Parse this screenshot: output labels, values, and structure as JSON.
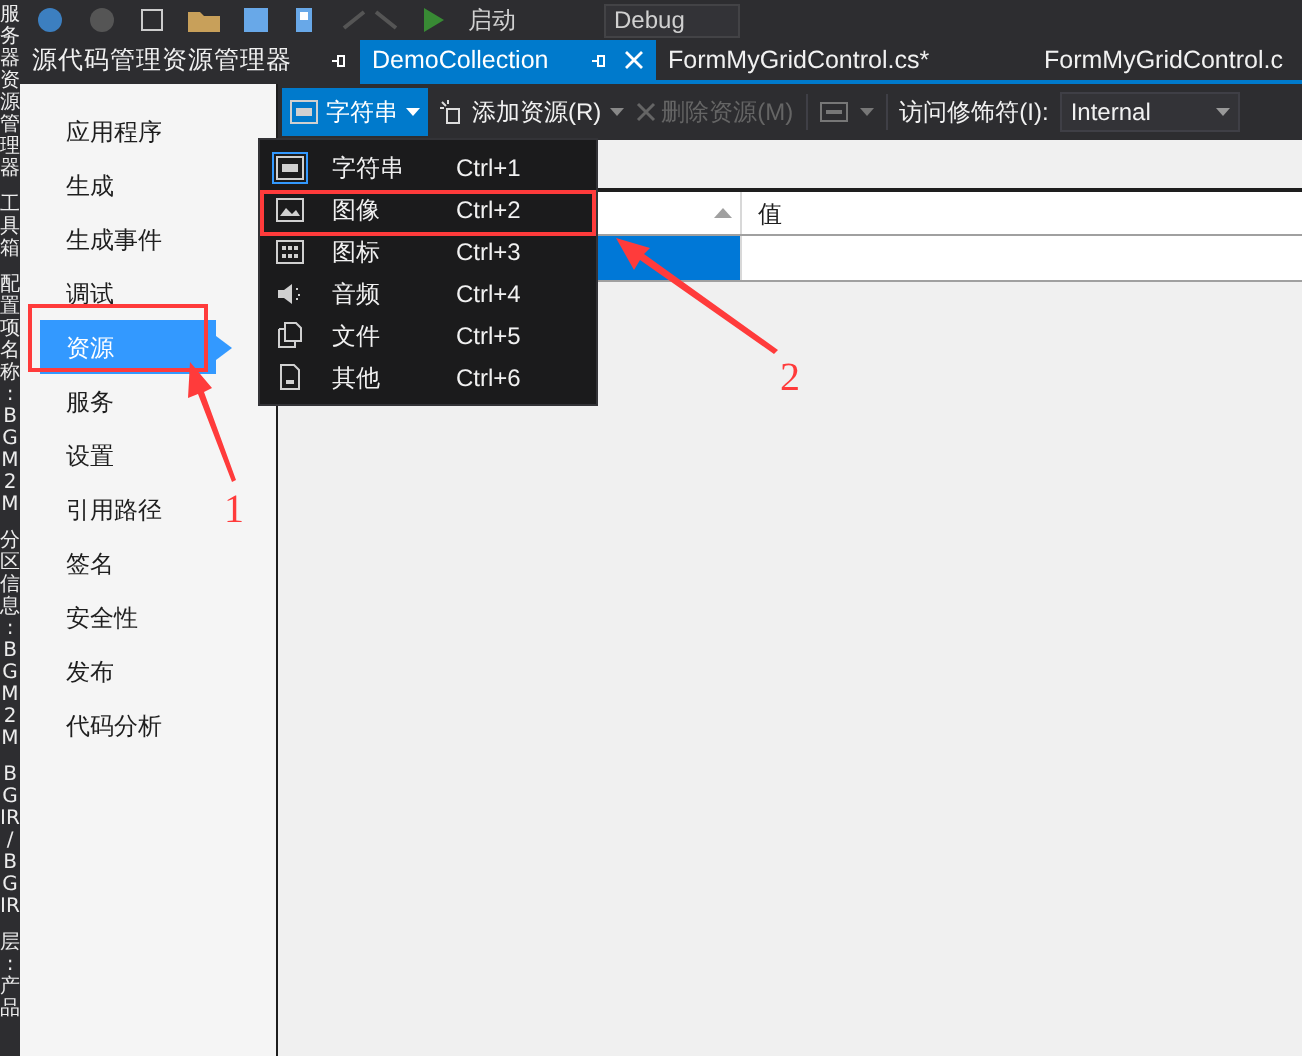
{
  "toolbar": {
    "run_label": "启动",
    "config": "Debug"
  },
  "side_strip": [
    {
      "label": "服务器资源管理器"
    },
    {
      "label": "工具箱"
    },
    {
      "label": "配置项名称:BGM2M"
    },
    {
      "label": "分区信息:BGM2M"
    },
    {
      "label": "BGIR/BGIR"
    },
    {
      "label": "层:产品"
    }
  ],
  "doc_tabs": [
    {
      "label": "源代码管理资源管理器",
      "kind": "tool",
      "selected": false
    },
    {
      "label": "DemoCollection",
      "kind": "doc",
      "selected": true
    },
    {
      "label": "FormMyGridControl.cs*",
      "kind": "doc",
      "selected": false
    },
    {
      "label": "FormMyGridControl.c",
      "kind": "doc",
      "selected": false
    }
  ],
  "nav": [
    {
      "label": "应用程序",
      "selected": false,
      "annotated": false
    },
    {
      "label": "生成",
      "selected": false,
      "annotated": false
    },
    {
      "label": "生成事件",
      "selected": false,
      "annotated": false
    },
    {
      "label": "调试",
      "selected": false,
      "annotated": false
    },
    {
      "label": "资源",
      "selected": true,
      "annotated": true
    },
    {
      "label": "服务",
      "selected": false,
      "annotated": false
    },
    {
      "label": "设置",
      "selected": false,
      "annotated": false
    },
    {
      "label": "引用路径",
      "selected": false,
      "annotated": false
    },
    {
      "label": "签名",
      "selected": false,
      "annotated": false
    },
    {
      "label": "安全性",
      "selected": false,
      "annotated": false
    },
    {
      "label": "发布",
      "selected": false,
      "annotated": false
    },
    {
      "label": "代码分析",
      "selected": false,
      "annotated": false
    }
  ],
  "resource_toolbar": {
    "type_button": "字符串",
    "add_button": "添加资源(R)",
    "remove_button": {
      "label": "删除资源(M)",
      "disabled": true
    },
    "access_label": "访问修饰符(I):",
    "access_value": "Internal"
  },
  "table": {
    "columns": [
      {
        "label": "值"
      }
    ],
    "rows": [
      {
        "selected": true
      }
    ]
  },
  "menu": {
    "items": [
      {
        "label": "字符串",
        "shortcut": "Ctrl+1",
        "kind": "string",
        "selected": true,
        "annotated": false
      },
      {
        "label": "图像",
        "shortcut": "Ctrl+2",
        "kind": "image",
        "selected": false,
        "annotated": true
      },
      {
        "label": "图标",
        "shortcut": "Ctrl+3",
        "kind": "icon",
        "selected": false,
        "annotated": false
      },
      {
        "label": "音频",
        "shortcut": "Ctrl+4",
        "kind": "audio",
        "selected": false,
        "annotated": false
      },
      {
        "label": "文件",
        "shortcut": "Ctrl+5",
        "kind": "file",
        "selected": false,
        "annotated": false
      },
      {
        "label": "其他",
        "shortcut": "Ctrl+6",
        "kind": "other",
        "selected": false,
        "annotated": false
      }
    ]
  },
  "annotations": [
    {
      "label": "1"
    },
    {
      "label": "2"
    }
  ]
}
